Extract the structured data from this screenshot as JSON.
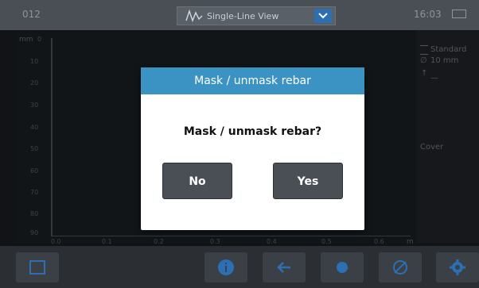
{
  "topbar": {
    "left_id": "012",
    "view_title": "Single-Line View",
    "time": "16:03",
    "icons": [
      "single-line-icon",
      "chevron-down-icon",
      "battery-icon"
    ]
  },
  "plot": {
    "y_unit": "mm",
    "y_ticks": [
      "0",
      "10",
      "20",
      "30",
      "40",
      "50",
      "60",
      "70",
      "80",
      "90"
    ],
    "x_ticks": [
      "0.0",
      "0.1",
      "0.2",
      "0.3",
      "0.4",
      "0.5",
      "0.6"
    ],
    "x_unit": "m"
  },
  "right_panel": {
    "mode": "Standard",
    "diameter": "10 mm",
    "depth": "—",
    "cover_label": "Cover"
  },
  "dialog": {
    "title": "Mask / unmask rebar",
    "message": "Mask / unmask rebar?",
    "no_label": "No",
    "yes_label": "Yes"
  },
  "bottombar": {
    "icons": [
      "fullscreen-icon",
      "info-icon",
      "back-arrow-icon",
      "record-icon",
      "diameter-icon",
      "settings-icon"
    ]
  }
}
